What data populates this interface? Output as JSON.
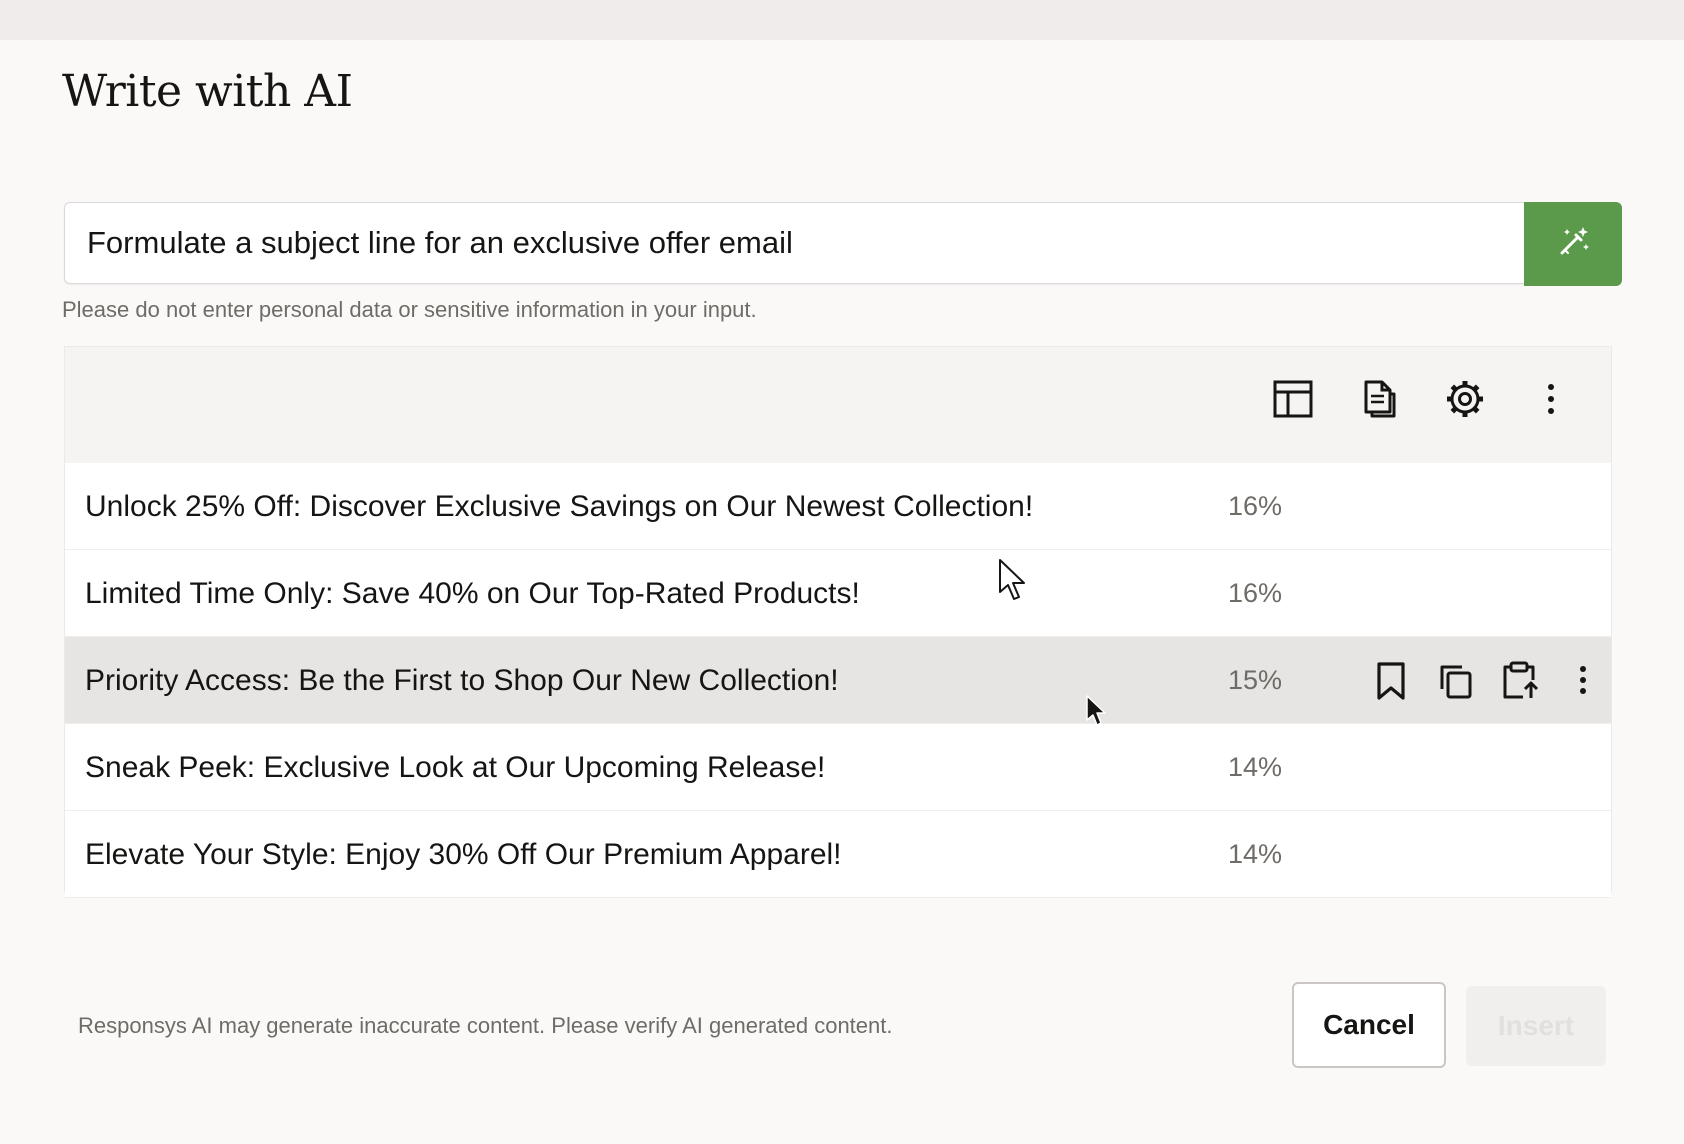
{
  "dialog": {
    "title": "Write with AI"
  },
  "prompt": {
    "value": "Formulate a subject line for an exclusive offer email",
    "helper": "Please do not enter personal data or sensitive information in your input.",
    "generate_icon": "magic-wand-icon"
  },
  "toolbar": {
    "icons": [
      "layout-icon",
      "document-copy-icon",
      "settings-gear-icon",
      "more-vertical-icon"
    ]
  },
  "results": [
    {
      "text": "Unlock 25% Off: Discover Exclusive Savings on Our Newest Collection!",
      "score": "16%"
    },
    {
      "text": "Limited Time Only: Save 40% on Our Top-Rated Products!",
      "score": "16%"
    },
    {
      "text": "Priority Access: Be the First to Shop Our New Collection!",
      "score": "15%",
      "active": true
    },
    {
      "text": "Sneak Peek: Exclusive Look at Our Upcoming Release!",
      "score": "14%"
    },
    {
      "text": "Elevate Your Style: Enjoy 30% Off Our Premium Apparel!",
      "score": "14%"
    }
  ],
  "row_actions": {
    "icons": [
      "bookmark-icon",
      "copy-icon",
      "clipboard-insert-icon",
      "more-vertical-icon"
    ]
  },
  "footer": {
    "note": "Responsys AI may generate inaccurate content. Please verify AI generated content.",
    "cancel_label": "Cancel",
    "insert_label": "Insert"
  },
  "colors": {
    "accent_green": "#5b9a4a",
    "active_row": "#e7e5e3",
    "background": "#fbf9f8"
  }
}
